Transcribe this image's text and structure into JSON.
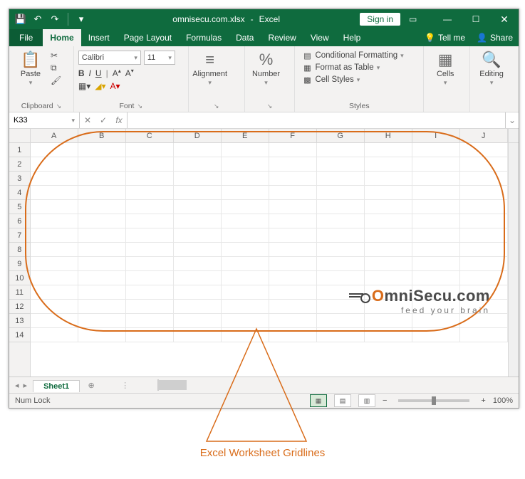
{
  "title": {
    "filename": "omnisecu.com.xlsx",
    "app": "Excel",
    "signin": "Sign in"
  },
  "menu": {
    "file": "File",
    "tabs": [
      "Home",
      "Insert",
      "Page Layout",
      "Formulas",
      "Data",
      "Review",
      "View",
      "Help"
    ],
    "active": "Home",
    "tellme": "Tell me",
    "share": "Share"
  },
  "ribbon": {
    "clipboard": {
      "name": "Clipboard",
      "paste": "Paste"
    },
    "font": {
      "name": "Font",
      "family": "Calibri",
      "size": "11",
      "bold": "B",
      "italic": "I",
      "underline": "U"
    },
    "alignment": {
      "name": "Alignment",
      "label": "Alignment"
    },
    "number": {
      "name": "Number",
      "label": "Number",
      "symbol": "%"
    },
    "styles": {
      "name": "Styles",
      "cond": "Conditional Formatting",
      "table": "Format as Table",
      "cell": "Cell Styles"
    },
    "cells": {
      "name": "Cells",
      "label": "Cells"
    },
    "editing": {
      "name": "Editing",
      "label": "Editing"
    }
  },
  "fx": {
    "namebox": "K33",
    "fx": "fx"
  },
  "grid": {
    "cols": [
      "A",
      "B",
      "C",
      "D",
      "E",
      "F",
      "G",
      "H",
      "I",
      "J"
    ],
    "rows": [
      "1",
      "2",
      "3",
      "4",
      "5",
      "6",
      "7",
      "8",
      "9",
      "10",
      "11",
      "12",
      "13",
      "14"
    ]
  },
  "sheet": {
    "name": "Sheet1"
  },
  "status": {
    "numlock": "Num Lock",
    "zoom": "100%",
    "minus": "−",
    "plus": "+"
  },
  "watermark": {
    "line1a": "O",
    "line1b": "mniSecu.com",
    "line2": "feed your brain"
  },
  "caption": "Excel Worksheet Gridlines"
}
